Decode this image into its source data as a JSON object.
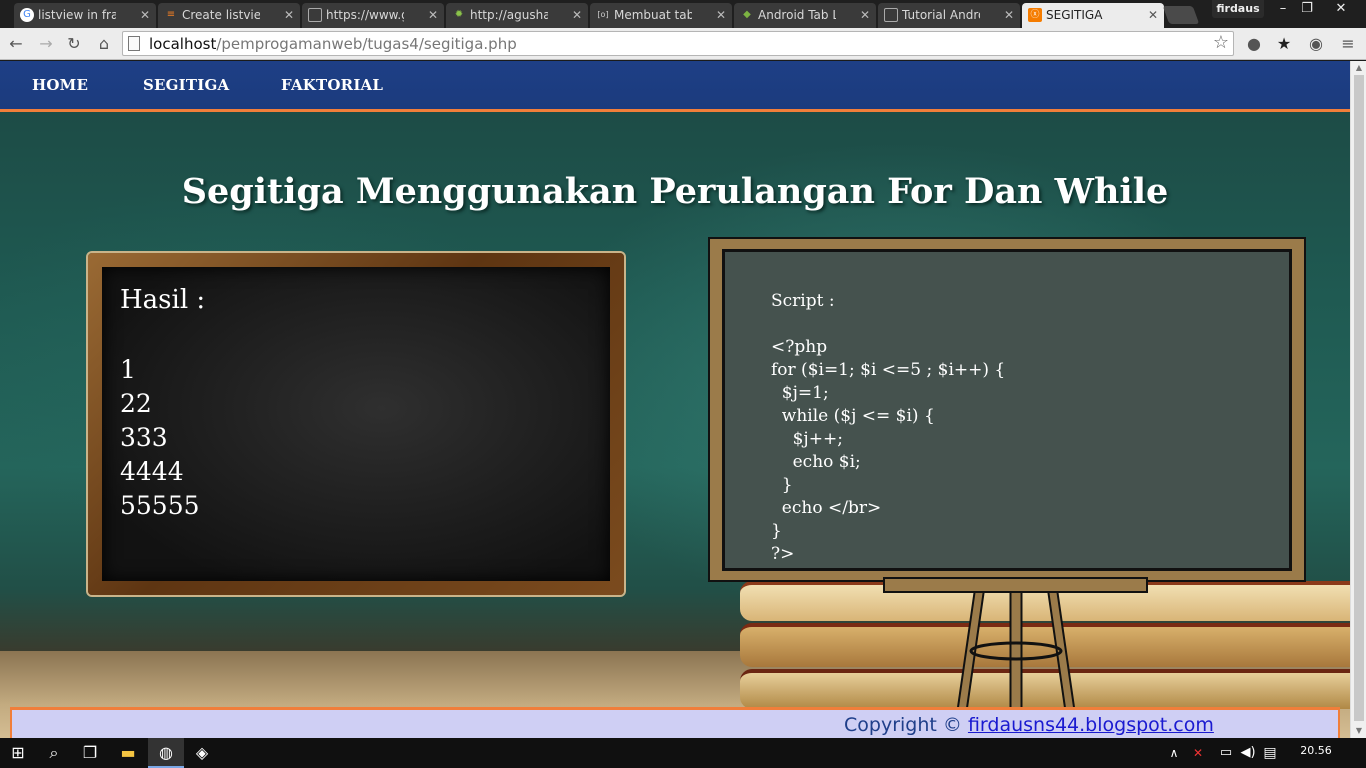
{
  "browser": {
    "tabs": [
      {
        "title": "listview in fragm",
        "icon": "google-icon",
        "active": false
      },
      {
        "title": "Create listview in",
        "icon": "stackoverflow-icon",
        "active": false
      },
      {
        "title": "https://www.goo",
        "icon": "page-icon",
        "active": false
      },
      {
        "title": "http://agusharya",
        "icon": "gear-icon",
        "active": false
      },
      {
        "title": "Membuat tab m",
        "icon": "blog-icon",
        "active": false
      },
      {
        "title": "Android Tab Lay",
        "icon": "android-icon",
        "active": false
      },
      {
        "title": "Tutorial Android",
        "icon": "page-icon",
        "active": false
      },
      {
        "title": "SEGITIGA",
        "icon": "xampp-icon",
        "active": true
      }
    ],
    "profile_name": "firdaus",
    "url_host": "localhost",
    "url_path": "/pemprogamanweb/tugas4/segitiga.php"
  },
  "page": {
    "nav": {
      "home": "HOME",
      "segitiga": "SEGITIGA",
      "faktorial": "FAKTORIAL"
    },
    "title": "Segitiga Menggunakan Perulangan For Dan While",
    "hasil_label": "Hasil :",
    "hasil_rows": [
      "1",
      "22",
      "333",
      "4444",
      "55555"
    ],
    "script_label": "Script :",
    "script_lines": [
      "<?php",
      "for ($i=1; $i <=5 ; $i++) {",
      "  $j=1;",
      "  while ($j <= $i) {",
      "    $j++;",
      "    echo $i;",
      "  }",
      "  echo </br>",
      "}",
      "?>"
    ],
    "footer_prefix": "Copyright ©",
    "footer_link": "firdausns44.blogspot.com"
  },
  "taskbar": {
    "time": "20.56"
  },
  "colors": {
    "nav_bg": "#1e3f86",
    "accent_orange": "#f07e3a",
    "footer_bg": "#cfcff4",
    "link_blue": "#1a1ad0"
  }
}
